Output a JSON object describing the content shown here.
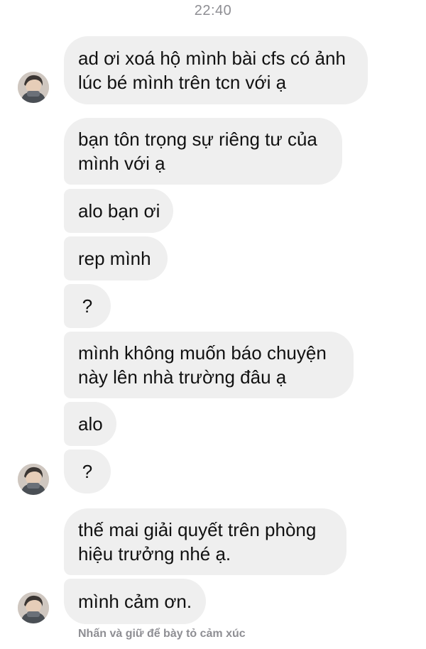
{
  "chat": {
    "timestamp": "22:40",
    "messages": [
      {
        "lines": [
          "ad ơi xoá hộ mình bài cfs có ảnh",
          "lúc bé mình trên tcn với ạ"
        ]
      },
      {
        "lines": [
          "bạn tôn trọng sự riêng tư của",
          "mình với ạ"
        ]
      },
      {
        "lines": [
          "alo bạn ơi"
        ]
      },
      {
        "lines": [
          "rep mình"
        ]
      },
      {
        "lines": [
          "?"
        ]
      },
      {
        "lines": [
          "mình không muốn báo chuyện",
          "này lên nhà trường đâu ạ"
        ]
      },
      {
        "lines": [
          "alo"
        ]
      },
      {
        "lines": [
          "?"
        ]
      },
      {
        "lines": [
          "thế mai giải quyết trên phòng",
          "hiệu trưởng nhé ạ."
        ]
      },
      {
        "lines": [
          "mình cảm ơn."
        ]
      }
    ],
    "reaction_hint": "Nhấn và giữ để bày tỏ cảm xúc"
  },
  "colors": {
    "bubble": "#efefef",
    "text": "#111111",
    "meta_text": "#8e8e93"
  }
}
